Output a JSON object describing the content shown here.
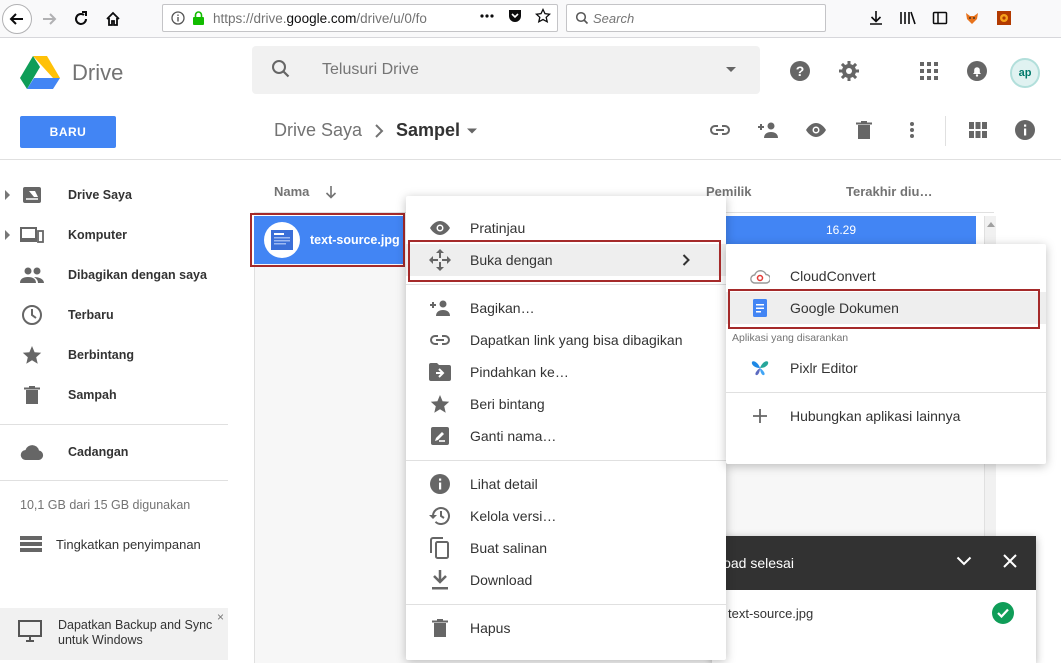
{
  "browser": {
    "url_prefix": "https://drive.",
    "url_domain": "google.com",
    "url_rest": "/drive/u/0/fo",
    "search_placeholder": "Search"
  },
  "drive": {
    "app_name": "Drive",
    "search_placeholder": "Telusuri Drive",
    "new_button": "BARU",
    "avatar_text": "ap"
  },
  "breadcrumb": {
    "root": "Drive Saya",
    "current": "Sampel"
  },
  "sidebar": {
    "items": [
      {
        "label": "Drive Saya",
        "icon": "drive-icon",
        "expandable": true
      },
      {
        "label": "Komputer",
        "icon": "computer-icon",
        "expandable": true
      },
      {
        "label": "Dibagikan dengan saya",
        "icon": "shared-people-icon",
        "expandable": false
      },
      {
        "label": "Terbaru",
        "icon": "clock-icon",
        "expandable": false
      },
      {
        "label": "Berbintang",
        "icon": "star-icon",
        "expandable": false
      },
      {
        "label": "Sampah",
        "icon": "trash-icon",
        "expandable": false
      },
      {
        "label": "Cadangan",
        "icon": "cloud-icon",
        "expandable": false
      }
    ],
    "storage": "10,1 GB dari 15 GB digunakan",
    "upgrade": "Tingkatkan penyimpanan",
    "promo_line1": "Dapatkan Backup and Sync",
    "promo_line2": "untuk Windows",
    "promo_close": "×"
  },
  "list": {
    "col_name": "Nama",
    "col_owner": "Pemilik",
    "col_modified": "Terakhir diu…",
    "file_name": "text-source.jpg",
    "file_modified": "16.29"
  },
  "context_menu": {
    "items": [
      {
        "label": "Pratinjau",
        "icon": "eye-icon"
      },
      {
        "label": "Buka dengan",
        "icon": "move-arrows-icon"
      },
      {
        "label": "Bagikan…",
        "icon": "add-person-icon"
      },
      {
        "label": "Dapatkan link yang bisa dibagikan",
        "icon": "link-icon"
      },
      {
        "label": "Pindahkan ke…",
        "icon": "move-folder-icon"
      },
      {
        "label": "Beri bintang",
        "icon": "star-icon"
      },
      {
        "label": "Ganti nama…",
        "icon": "rename-icon"
      },
      {
        "label": "Lihat detail",
        "icon": "info-icon"
      },
      {
        "label": "Kelola versi…",
        "icon": "history-icon"
      },
      {
        "label": "Buat salinan",
        "icon": "copy-icon"
      },
      {
        "label": "Download",
        "icon": "download-icon"
      },
      {
        "label": "Hapus",
        "icon": "trash-icon"
      }
    ]
  },
  "open_with": {
    "items": [
      {
        "label": "CloudConvert",
        "icon": "cloudconvert-icon"
      },
      {
        "label": "Google Dokumen",
        "icon": "google-docs-icon"
      },
      {
        "label": "Pixlr Editor",
        "icon": "pixlr-butterfly-icon"
      },
      {
        "label": "Hubungkan aplikasi lainnya",
        "icon": "plus-icon"
      }
    ],
    "section_label": "Aplikasi yang disarankan"
  },
  "upload": {
    "title": "load selesai",
    "file": "text-source.jpg"
  },
  "colors": {
    "accent": "#4285f4",
    "highlight_border": "#a52a2a",
    "success": "#0f9d58"
  }
}
